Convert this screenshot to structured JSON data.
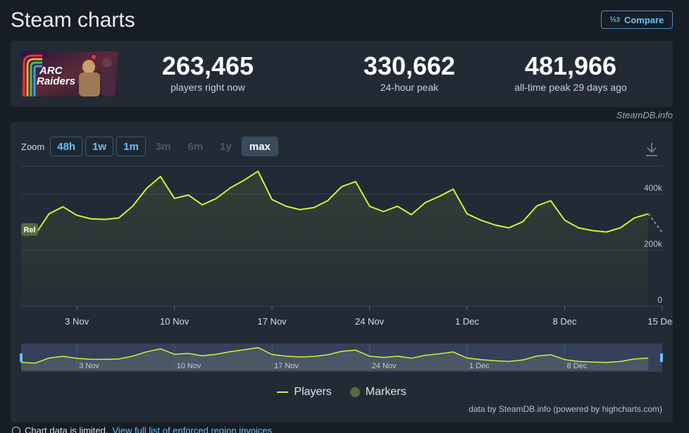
{
  "page": {
    "title": "Steam charts",
    "compare_label": "Compare",
    "compare_icon": "1/2/3"
  },
  "game": {
    "capsule_text_1": "ARC",
    "capsule_text_2": "Raiders"
  },
  "stats": [
    {
      "value": "263,465",
      "label": "players right now"
    },
    {
      "value": "330,662",
      "label": "24-hour peak"
    },
    {
      "value": "481,966",
      "label": "all-time peak 29 days ago"
    }
  ],
  "credit": "SteamDB.info",
  "zoom": {
    "label": "Zoom",
    "buttons": [
      {
        "label": "48h",
        "state": "enabled"
      },
      {
        "label": "1w",
        "state": "enabled"
      },
      {
        "label": "1m",
        "state": "enabled"
      },
      {
        "label": "3m",
        "state": "disabled"
      },
      {
        "label": "6m",
        "state": "disabled"
      },
      {
        "label": "1y",
        "state": "disabled"
      },
      {
        "label": "max",
        "state": "active"
      }
    ]
  },
  "legend": {
    "players": "Players",
    "markers": "Markers"
  },
  "source_credit": "data by SteamDB.info (powered by highcharts.com)",
  "bottom_note": {
    "text": "Chart data is limited.",
    "link": "View full list of enforced region invoices"
  },
  "colors": {
    "line": "#d4f03c",
    "marker": "#556b3d",
    "accent": "#66c0f4"
  },
  "chart_data": {
    "type": "line",
    "ylim": [
      0,
      500000
    ],
    "yticks": [
      {
        "value": 0,
        "label": "0"
      },
      {
        "value": 200000,
        "label": "200k"
      },
      {
        "value": 400000,
        "label": "400k"
      }
    ],
    "xticks": [
      "3 Nov",
      "10 Nov",
      "17 Nov",
      "24 Nov",
      "1 Dec",
      "8 Dec",
      "15 Dec"
    ],
    "x_start": "2025-10-30",
    "x_end": "2025-12-15",
    "marker_label": "Rel",
    "series": [
      {
        "name": "Players",
        "points": [
          [
            "2025-10-30",
            265000
          ],
          [
            "2025-10-31",
            255000
          ],
          [
            "2025-11-01",
            330000
          ],
          [
            "2025-11-02",
            355000
          ],
          [
            "2025-11-03",
            325000
          ],
          [
            "2025-11-04",
            312000
          ],
          [
            "2025-11-05",
            310000
          ],
          [
            "2025-11-06",
            315000
          ],
          [
            "2025-11-07",
            357000
          ],
          [
            "2025-11-08",
            420000
          ],
          [
            "2025-11-09",
            463000
          ],
          [
            "2025-11-10",
            385000
          ],
          [
            "2025-11-11",
            397000
          ],
          [
            "2025-11-12",
            362000
          ],
          [
            "2025-11-13",
            385000
          ],
          [
            "2025-11-14",
            422000
          ],
          [
            "2025-11-15",
            450000
          ],
          [
            "2025-11-16",
            482000
          ],
          [
            "2025-11-17",
            381000
          ],
          [
            "2025-11-18",
            357000
          ],
          [
            "2025-11-19",
            345000
          ],
          [
            "2025-11-20",
            352000
          ],
          [
            "2025-11-21",
            377000
          ],
          [
            "2025-11-22",
            427000
          ],
          [
            "2025-11-23",
            445000
          ],
          [
            "2025-11-24",
            357000
          ],
          [
            "2025-11-25",
            338000
          ],
          [
            "2025-11-26",
            357000
          ],
          [
            "2025-11-27",
            327000
          ],
          [
            "2025-11-28",
            370000
          ],
          [
            "2025-11-29",
            392000
          ],
          [
            "2025-11-30",
            418000
          ],
          [
            "2025-12-01",
            330000
          ],
          [
            "2025-12-02",
            307000
          ],
          [
            "2025-12-03",
            290000
          ],
          [
            "2025-12-04",
            280000
          ],
          [
            "2025-12-05",
            302000
          ],
          [
            "2025-12-06",
            358000
          ],
          [
            "2025-12-07",
            377000
          ],
          [
            "2025-12-08",
            307000
          ],
          [
            "2025-12-09",
            280000
          ],
          [
            "2025-12-10",
            270000
          ],
          [
            "2025-12-11",
            265000
          ],
          [
            "2025-12-12",
            280000
          ],
          [
            "2025-12-13",
            315000
          ],
          [
            "2025-12-14",
            330000
          ]
        ]
      }
    ],
    "navigator": {
      "xticks": [
        "3 Nov",
        "10 Nov",
        "17 Nov",
        "24 Nov",
        "1 Dec",
        "8 Dec"
      ]
    }
  }
}
